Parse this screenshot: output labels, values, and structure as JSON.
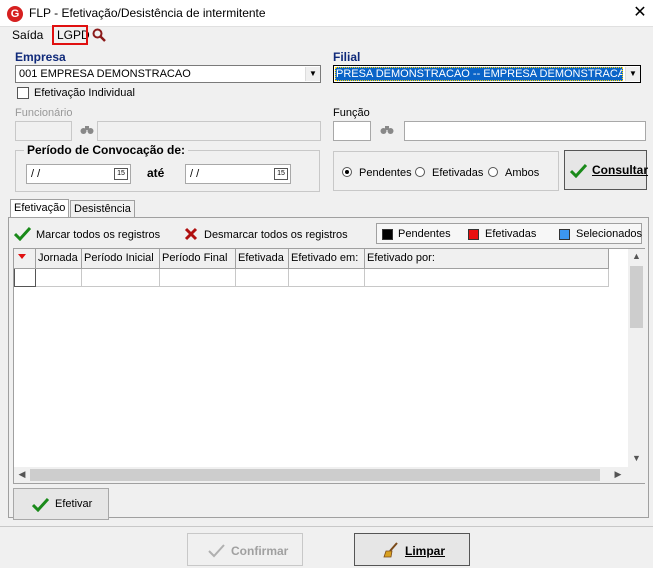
{
  "window": {
    "title": "FLP - Efetivação/Desistência de intermitente",
    "close_glyph": "✕",
    "app_icon_letter": "G"
  },
  "menu": {
    "saida": "Saída",
    "lgpd": "LGPD"
  },
  "empresa": {
    "label": "Empresa",
    "value": "001 EMPRESA DEMONSTRACAO"
  },
  "filial": {
    "label": "Filial",
    "value": "PRESA DEMONSTRACAO -- EMPRESA DEMONSTRACAO"
  },
  "efetivacao_individual": {
    "label": "Efetivação Individual",
    "checked": false
  },
  "funcionario": {
    "label": "Funcionário"
  },
  "funcao": {
    "label": "Função"
  },
  "periodo": {
    "title": "Período de Convocação de:",
    "from": " / /",
    "ate": "até",
    "to": " / /",
    "cal_label": "15"
  },
  "filtro": {
    "pendentes": "Pendentes",
    "efetivadas": "Efetivadas",
    "ambos": "Ambos",
    "selected": "pendentes"
  },
  "consultar_button": "Consultar",
  "tabs": [
    {
      "label": "Efetivação"
    },
    {
      "label": "Desistência"
    }
  ],
  "toolbar": {
    "marcar": "Marcar todos os registros",
    "desmarcar": "Desmarcar todos os registros"
  },
  "legend": [
    {
      "label": "Pendentes",
      "color": "#000000"
    },
    {
      "label": "Efetivadas",
      "color": "#e81010"
    },
    {
      "label": "Selecionados",
      "color": "#3c96f0"
    }
  ],
  "grid": {
    "columns": [
      "Jornada",
      "Período Inicial",
      "Período Final",
      "Efetivada",
      "Efetivado em:",
      "Efetivado por:"
    ]
  },
  "efetivar_button": "Efetivar",
  "confirmar_button": "Confirmar",
  "limpar_button": "Limpar",
  "colors": {
    "accent_check": "#1a8a1a",
    "accent_x": "#b01010",
    "highlight": "#0a64c8",
    "title_label": "#102a7a"
  }
}
